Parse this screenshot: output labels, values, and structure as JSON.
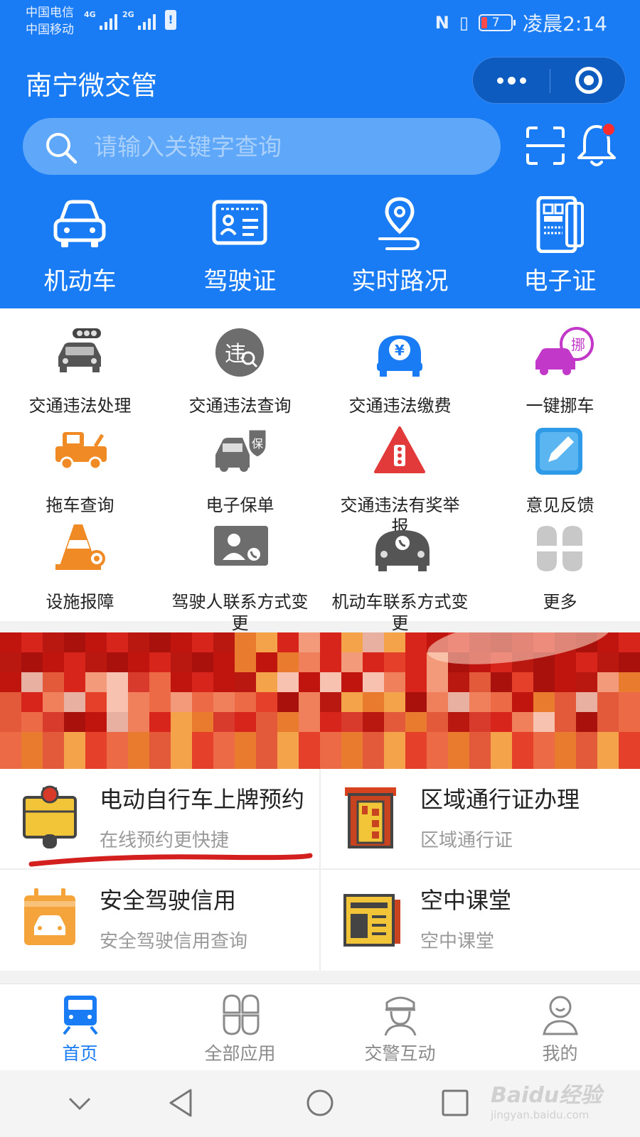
{
  "status_bar": {
    "carrier1": "中国电信",
    "carrier2": "中国移动",
    "net1": "4G",
    "net2": "2G",
    "battery_level": "7",
    "time": "凌晨2:14"
  },
  "header": {
    "title": "南宁微交管"
  },
  "search": {
    "placeholder": "请输入关键字查询"
  },
  "quick_nav": [
    {
      "label": "机动车",
      "icon": "car-icon"
    },
    {
      "label": "驾驶证",
      "icon": "license-icon"
    },
    {
      "label": "实时路况",
      "icon": "location-route-icon"
    },
    {
      "label": "电子证",
      "icon": "e-certificate-icon"
    }
  ],
  "services": [
    {
      "label": "交通违法处理"
    },
    {
      "label": "交通违法查询"
    },
    {
      "label": "交通违法缴费"
    },
    {
      "label": "一键挪车"
    },
    {
      "label": "拖车查询"
    },
    {
      "label": "电子保单"
    },
    {
      "label": "交通违法有奖举报"
    },
    {
      "label": "意见反馈"
    },
    {
      "label": "设施报障"
    },
    {
      "label": "驾驶人联系方式变更"
    },
    {
      "label": "机动车联系方式变更"
    },
    {
      "label": "更多"
    }
  ],
  "cards": [
    {
      "title": "电动自行车上牌预约",
      "subtitle": "在线预约更快捷"
    },
    {
      "title": "区域通行证办理",
      "subtitle": "区域通行证"
    },
    {
      "title": "安全驾驶信用",
      "subtitle": "安全驾驶信用查询"
    },
    {
      "title": "空中课堂",
      "subtitle": "空中课堂"
    }
  ],
  "tabbar": [
    {
      "label": "首页",
      "active": true
    },
    {
      "label": "全部应用",
      "active": false
    },
    {
      "label": "交警互动",
      "active": false
    },
    {
      "label": "我的",
      "active": false
    }
  ],
  "watermark": {
    "brand": "Baidu经验",
    "url": "jingyan.baidu.com"
  },
  "colors": {
    "primary": "#1a7cf4",
    "badge": "#ff2d2d",
    "tab_active": "#1a7cf4"
  }
}
